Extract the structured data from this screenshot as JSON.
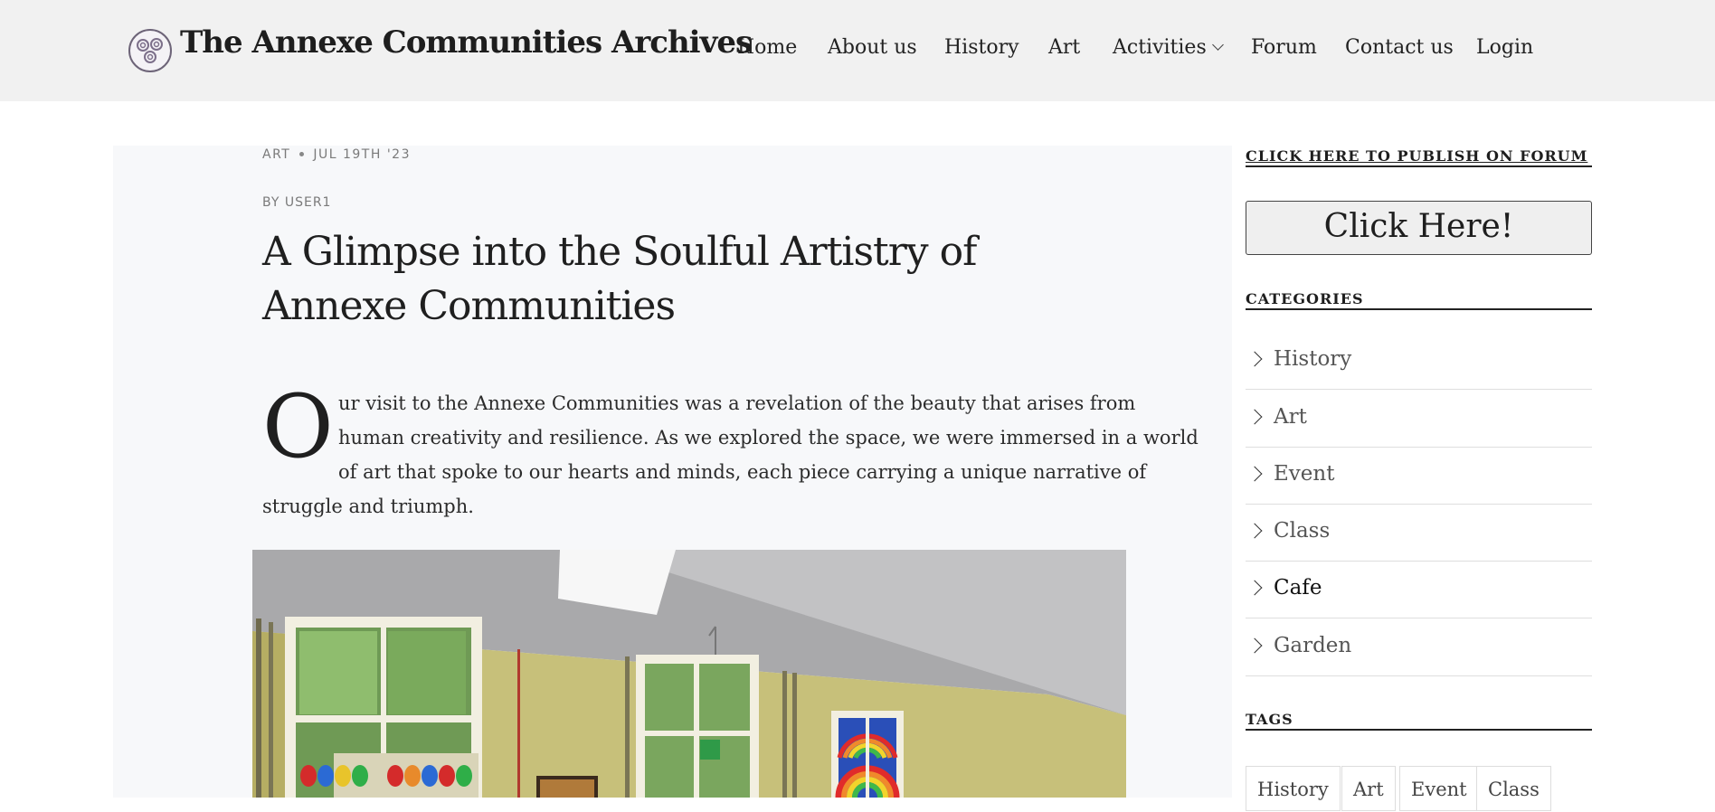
{
  "header": {
    "site_title": "The Annexe Communities Archives",
    "nav": [
      "Home",
      "About us",
      "History",
      "Art",
      "Activities",
      "Forum",
      "Contact us",
      "Login"
    ]
  },
  "post": {
    "category": "ART",
    "date": "JUL 19TH '23",
    "byline": "BY USER1",
    "title": "A Glimpse into the Soulful Artistry of Annexe Communities",
    "dropcap": "O",
    "body_lines": [
      "ur visit to the Annexe Communities was a revelation of the beauty that arises from",
      "human creativity and resilience. As we explored the space, we were immersed in a world",
      "of art that spoke to our hearts and minds, each piece carrying a unique narrative of",
      "struggle and triumph."
    ]
  },
  "sidebar": {
    "publish_heading": "CLICK HERE TO PUBLISH ON FORUM",
    "publish_button": "Click Here!",
    "categories_heading": "CATEGORIES",
    "categories": [
      "History",
      "Art",
      "Event",
      "Class",
      "Cafe",
      "Garden"
    ],
    "active_category": "Cafe",
    "tags_heading": "TAGS",
    "tags": [
      "History",
      "Art",
      "Event",
      "Class"
    ]
  },
  "colors": {
    "header_bg": "#f1f1f1",
    "content_bg": "#f7f8fa",
    "text": "#222222",
    "meta": "#7a7a7a"
  }
}
